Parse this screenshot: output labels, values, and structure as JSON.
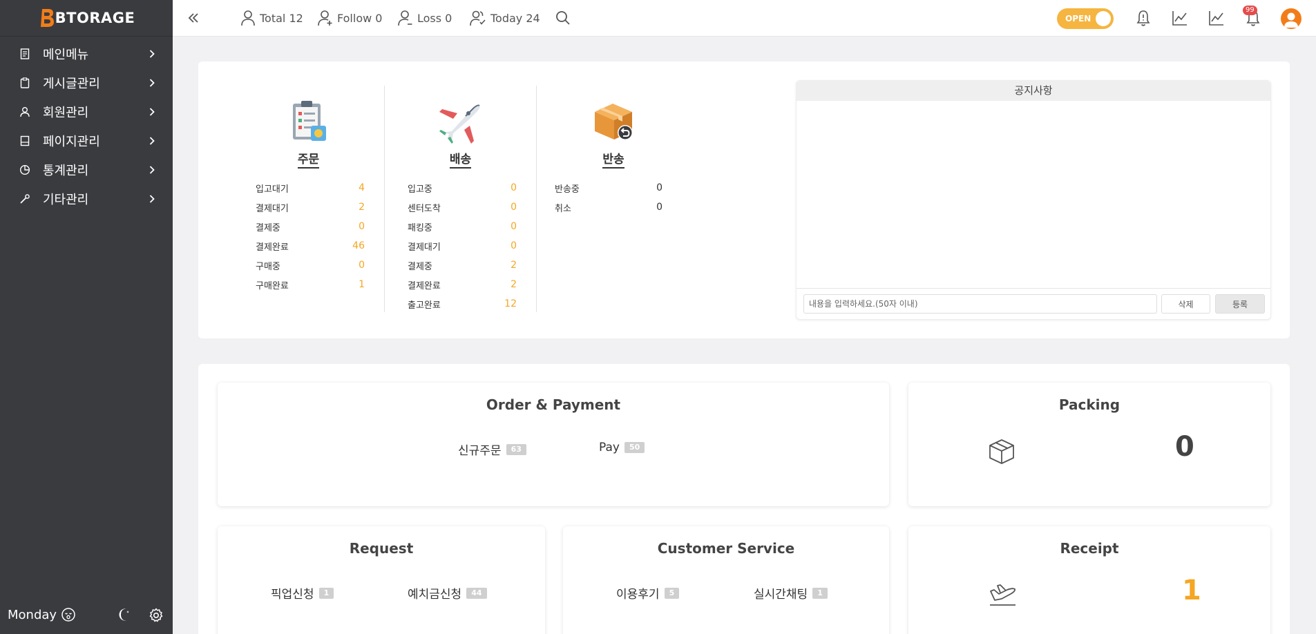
{
  "brand": {
    "name": "BTORAGE"
  },
  "sidebar": {
    "items": [
      {
        "label": "메인메뉴",
        "icon": "document-icon"
      },
      {
        "label": "게시글관리",
        "icon": "clipboard-icon"
      },
      {
        "label": "회원관리",
        "icon": "user-icon"
      },
      {
        "label": "페이지관리",
        "icon": "page-icon"
      },
      {
        "label": "통계관리",
        "icon": "pie-chart-icon"
      },
      {
        "label": "기타관리",
        "icon": "tools-icon"
      }
    ],
    "footer": {
      "day": "Monday"
    }
  },
  "header": {
    "stats": [
      {
        "label": "Total 12",
        "icon": "user-icon"
      },
      {
        "label": "Follow 0",
        "icon": "user-plus-icon"
      },
      {
        "label": "Loss 0",
        "icon": "user-minus-icon"
      },
      {
        "label": "Today 24",
        "icon": "users-icon"
      }
    ],
    "toggle_label": "OPEN",
    "notification_count": "99"
  },
  "summary": {
    "order": {
      "title": "주문",
      "rows": [
        {
          "label": "입고대기",
          "value": "4"
        },
        {
          "label": "결제대기",
          "value": "2"
        },
        {
          "label": "결제중",
          "value": "0"
        },
        {
          "label": "결제완료",
          "value": "46"
        },
        {
          "label": "구매중",
          "value": "0"
        },
        {
          "label": "구매완료",
          "value": "1"
        }
      ]
    },
    "delivery": {
      "title": "배송",
      "rows": [
        {
          "label": "입고중",
          "value": "0"
        },
        {
          "label": "센터도착",
          "value": "0"
        },
        {
          "label": "패킹중",
          "value": "0"
        },
        {
          "label": "결제대기",
          "value": "0"
        },
        {
          "label": "결제중",
          "value": "2"
        },
        {
          "label": "결제완료",
          "value": "2"
        },
        {
          "label": "출고완료",
          "value": "12"
        }
      ]
    },
    "return": {
      "title": "반송",
      "rows": [
        {
          "label": "반송중",
          "value": "0"
        },
        {
          "label": "취소",
          "value": "0"
        }
      ]
    }
  },
  "notice": {
    "title": "공지사항",
    "input_placeholder": "내용을 입력하세요.(50자 이내)",
    "delete_label": "삭제",
    "register_label": "등록"
  },
  "cards": {
    "order_payment": {
      "title": "Order & Payment",
      "items": [
        {
          "label": "신규주문",
          "count": "63"
        },
        {
          "label": "Pay",
          "count": "50"
        }
      ]
    },
    "packing": {
      "title": "Packing",
      "value": "0"
    },
    "request": {
      "title": "Request",
      "items": [
        {
          "label": "픽업신청",
          "count": "1"
        },
        {
          "label": "예치금신청",
          "count": "44"
        }
      ]
    },
    "customer_service": {
      "title": "Customer Service",
      "items": [
        {
          "label": "이용후기",
          "count": "5"
        },
        {
          "label": "실시간채팅",
          "count": "1"
        }
      ]
    },
    "receipt": {
      "title": "Receipt",
      "value": "1"
    }
  },
  "colors": {
    "accent": "#f5a623",
    "toggle": "#f5b540",
    "sidebar": "#3a3b3f",
    "logo": "#f27d18",
    "badge": "#e64b4b"
  }
}
